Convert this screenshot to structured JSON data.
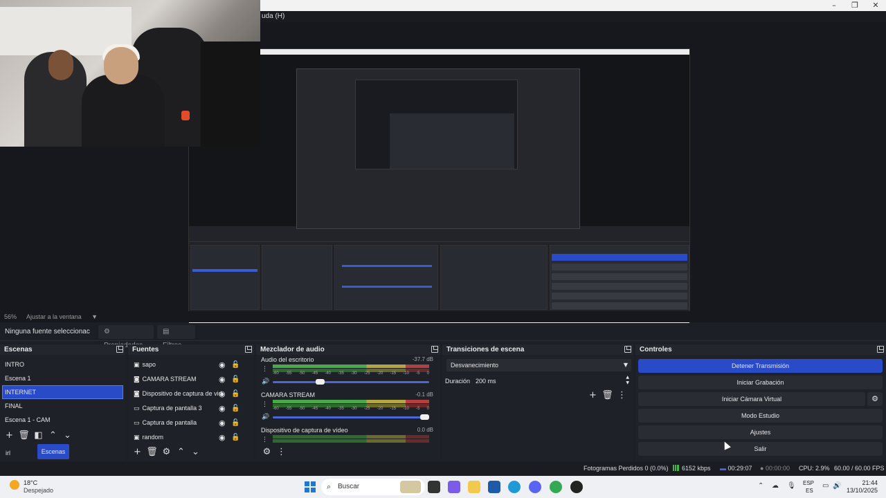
{
  "window": {
    "menu_fragment": "uda (H)",
    "minimize": "–",
    "restore": "❐",
    "close": "✕"
  },
  "preview": {
    "zoom": "56%",
    "zoom_mode": "Ajustar a la ventana"
  },
  "toolbar": {
    "no_source": "Ninguna fuente seleccionac",
    "properties": "Propiedades",
    "filters": "Filtros"
  },
  "scenes": {
    "title": "Escenas",
    "items": [
      "INTRO",
      "Escena 1",
      "INTERNET",
      "FINAL",
      "Escena 1 - CAM"
    ],
    "selected_index": 2,
    "tabs": [
      "irl",
      "Escenas"
    ]
  },
  "sources": {
    "title": "Fuentes",
    "items": [
      {
        "label": "sapo",
        "icon": "image-icon"
      },
      {
        "label": "CAMARA STREAM",
        "icon": "camera-icon"
      },
      {
        "label": "Dispositivo de captura de vid",
        "icon": "camera-icon"
      },
      {
        "label": "Captura de pantalla 3",
        "icon": "monitor-icon"
      },
      {
        "label": "Captura de pantalla",
        "icon": "monitor-icon"
      },
      {
        "label": "random",
        "icon": "image-icon"
      }
    ]
  },
  "mixer": {
    "title": "Mezclador de audio",
    "ticks": [
      "-60",
      "-55",
      "-50",
      "-45",
      "-40",
      "-35",
      "-30",
      "-25",
      "-20",
      "-15",
      "-10",
      "-5",
      "0"
    ],
    "channels": [
      {
        "name": "Audio del escritorio",
        "db": "-37.7 dB",
        "volume": 0.31
      },
      {
        "name": "CAMARA STREAM",
        "db": "-0.1 dB",
        "volume": 1.0
      },
      {
        "name": "Dispositivo de captura de vídeo",
        "db": "0.0 dB",
        "volume": 1.0
      }
    ]
  },
  "transitions": {
    "title": "Transiciones de escena",
    "selected": "Desvanecimiento",
    "duration_label": "Duración",
    "duration_value": "200 ms"
  },
  "controls": {
    "title": "Controles",
    "stop_stream": "Detener Transmisión",
    "start_record": "Iniciar Grabación",
    "virtual_cam": "Iniciar Cámara Virtual",
    "studio_mode": "Modo Estudio",
    "settings": "Ajustes",
    "exit": "Salir"
  },
  "status": {
    "dropped_frames": "Fotogramas Perdidos 0 (0.0%)",
    "bitrate": "6152 kbps",
    "stream_time": "00:29:07",
    "record_time": "00:00:00",
    "cpu": "CPU: 2.9%",
    "fps": "60.00 / 60.00 FPS"
  },
  "taskbar": {
    "temp": "18°C",
    "weather": "Despejado",
    "search": "Buscar",
    "lang": "ESP",
    "lang_sub": "ES",
    "time": "21:44",
    "date": "13/10/2025"
  },
  "colors": {
    "accent": "#2a4bc8",
    "panel": "#1f2129",
    "background": "#1d1f26"
  }
}
